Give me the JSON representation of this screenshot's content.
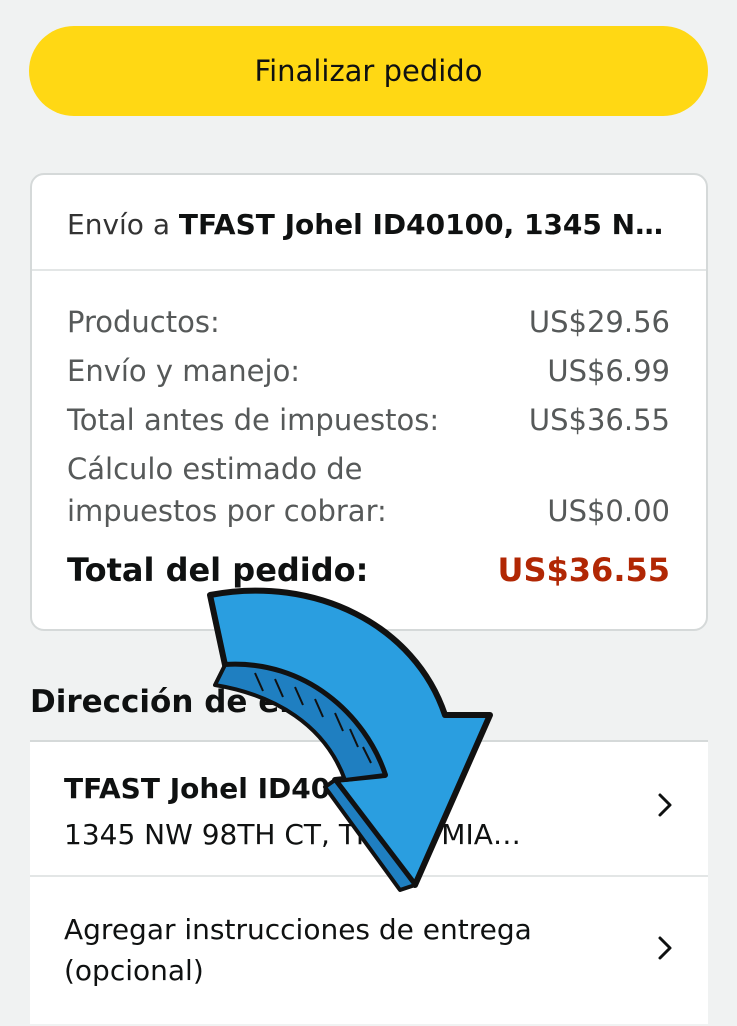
{
  "checkout_button": {
    "label": "Finalizar pedido"
  },
  "summary": {
    "ship_to_prefix": "Envío a",
    "ship_to_name": "TFAST Johel ID40100, 1345 N…",
    "rows": [
      {
        "label": "Productos:",
        "value": "US$29.56"
      },
      {
        "label": "Envío y manejo:",
        "value": "US$6.99"
      },
      {
        "label": "Total antes de impuestos:",
        "value": "US$36.55"
      },
      {
        "label_line1": "Cálculo estimado de",
        "label_line2": "impuestos por cobrar:",
        "value": "US$0.00"
      }
    ],
    "total": {
      "label": "Total del pedido:",
      "value": "US$36.55"
    }
  },
  "shipping_address": {
    "section_title": "Dirección de envío",
    "name": "TFAST Johel ID40100",
    "line": "1345 NW 98TH CT, TFAST, MIA…",
    "instructions": "Agregar instrucciones de entrega (opcional)"
  },
  "colors": {
    "button_bg": "#ffd814",
    "total_red": "#b12704",
    "annotation_arrow": "#2a9ee0"
  },
  "icons": {
    "chevron": "chevron-right-icon",
    "annotation": "arrow-annotation-icon"
  }
}
